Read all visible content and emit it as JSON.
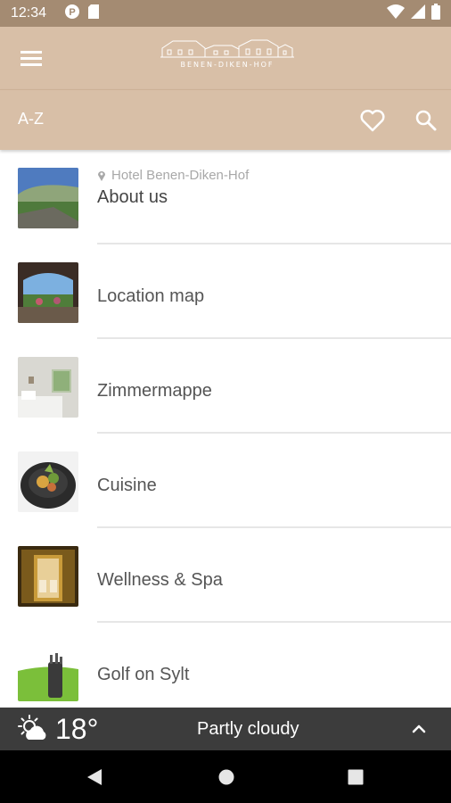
{
  "status_bar": {
    "time": "12:34"
  },
  "app_bar": {
    "logo_text": "BENEN-DIKEN-HOF"
  },
  "sub_bar": {
    "title": "A-Z"
  },
  "items": [
    {
      "label": "About us",
      "sublabel": "Hotel Benen-Diken-Hof"
    },
    {
      "label": "Location map"
    },
    {
      "label": "Zimmermappe"
    },
    {
      "label": "Cuisine"
    },
    {
      "label": "Wellness & Spa"
    },
    {
      "label": "Golf on Sylt"
    }
  ],
  "weather": {
    "temperature": "18°",
    "condition": "Partly cloudy"
  },
  "colors": {
    "status_bar": "#a48b72",
    "app_bar": "#d8bfa7",
    "weather_bar": "#3c3c3c",
    "nav_bar": "#000000"
  }
}
